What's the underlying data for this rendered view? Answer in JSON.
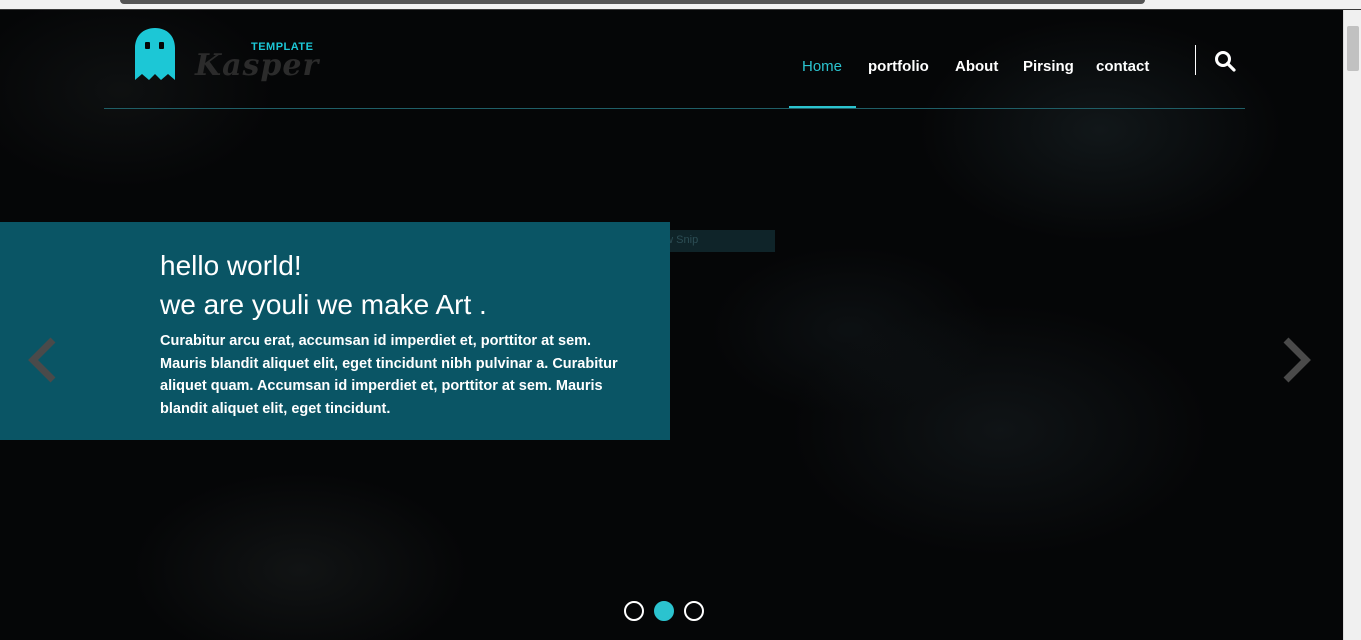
{
  "header": {
    "logo": {
      "script_text": "Kasper",
      "tag_text": "TEMPLATE",
      "icon": "ghost-icon",
      "color": "#1cc7d6"
    },
    "nav": [
      {
        "label": "Home",
        "active": true
      },
      {
        "label": "portfolio",
        "active": false
      },
      {
        "label": "About",
        "active": false
      },
      {
        "label": "Pirsing",
        "active": false
      },
      {
        "label": "contact",
        "active": false
      }
    ],
    "search_icon": "search-icon",
    "accent_color": "#2bc3cf"
  },
  "overlay": {
    "window_snip_label": "Window Snip"
  },
  "hero": {
    "title_line1": "hello world!",
    "title_line2": "we are youli we make Art .",
    "text": "Curabitur arcu erat, accumsan id imperdiet et, porttitor at sem. Mauris blandit aliquet elit, eget tincidunt nibh pulvinar a. Curabitur aliquet quam. Accumsan id imperdiet et, porttitor at sem. Mauris blandit aliquet elit, eget tincidunt.",
    "box_color": "#0a5565"
  },
  "slider": {
    "prev_icon": "chevron-left-icon",
    "next_icon": "chevron-right-icon",
    "slide_count": 3,
    "active_slide": 2
  }
}
